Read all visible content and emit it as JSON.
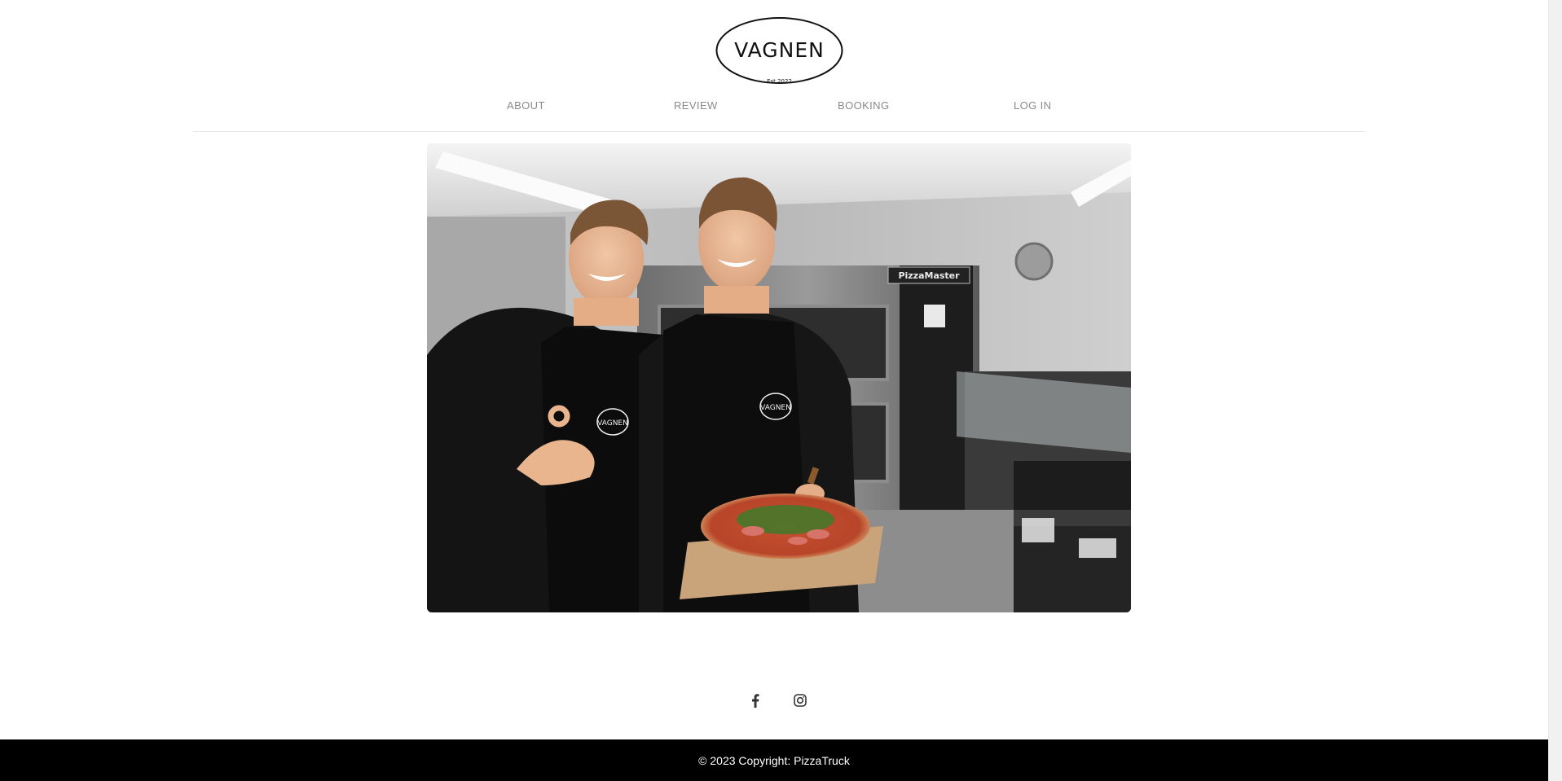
{
  "brand": {
    "name": "VAGNEN",
    "established": "Est 2022"
  },
  "nav": {
    "items": [
      {
        "label": "ABOUT"
      },
      {
        "label": "REVIEW"
      },
      {
        "label": "BOOKING"
      },
      {
        "label": "LOG IN"
      }
    ]
  },
  "hero": {
    "apron_logo": "VAGNEN",
    "oven_brand": "PizzaMaster"
  },
  "social": {
    "icons": [
      "facebook-icon",
      "instagram-icon"
    ]
  },
  "footer": {
    "copyright": "© 2023 Copyright: PizzaTruck"
  },
  "colors": {
    "footer_bg": "#000000",
    "nav_text": "#8a8a8a",
    "icon": "#333333"
  }
}
